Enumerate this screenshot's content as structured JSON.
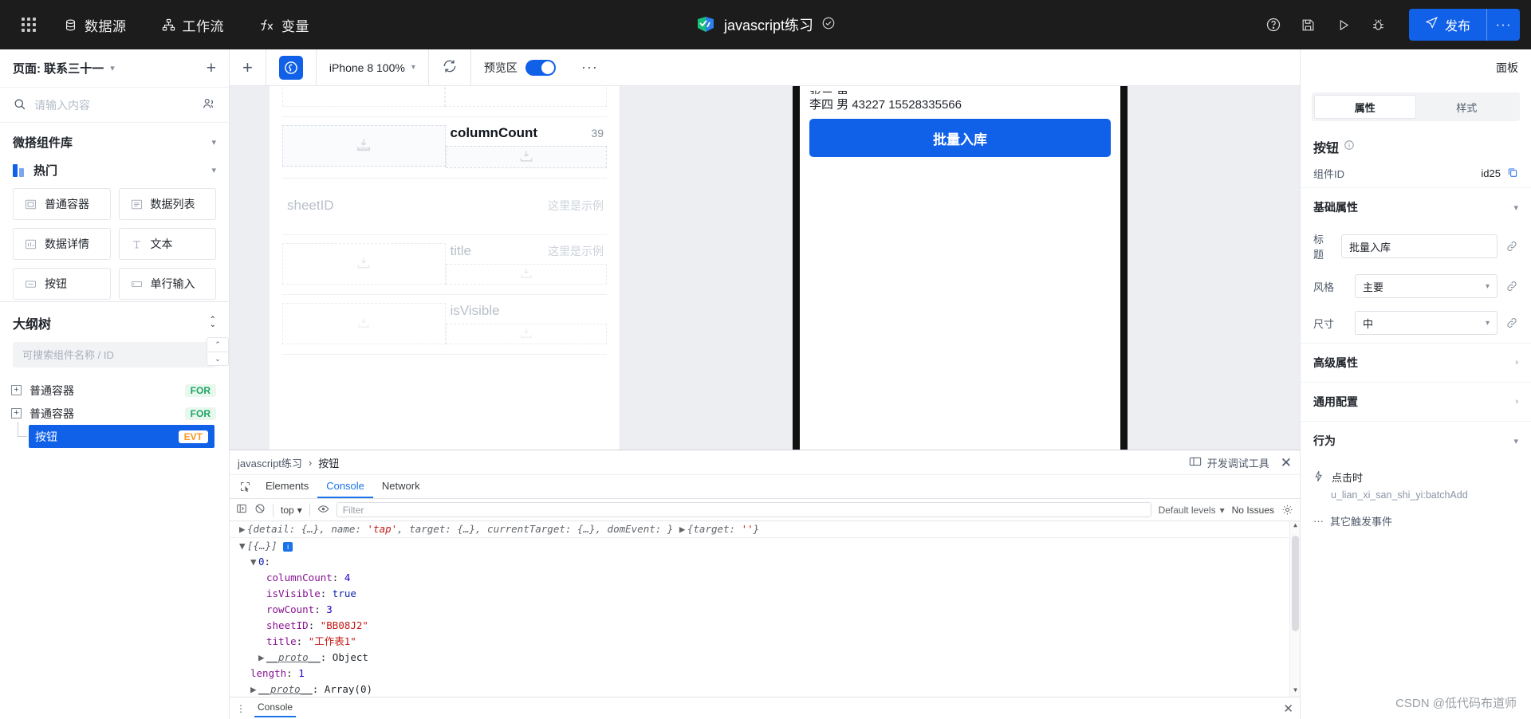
{
  "topbar": {
    "menu": [
      {
        "label": "数据源",
        "icon": "database-icon"
      },
      {
        "label": "工作流",
        "icon": "workflow-icon"
      },
      {
        "label": "变量",
        "icon": "function-icon"
      }
    ],
    "app_title": "javascript练习",
    "icons": [
      "help-icon",
      "save-icon",
      "play-icon",
      "debug-icon"
    ],
    "publish_label": "发布",
    "more_label": "···"
  },
  "sidebar": {
    "page_prefix": "页面:",
    "page_name": "联系三十一",
    "add_label": "+",
    "search_placeholder": "请输入内容",
    "library_title": "微搭组件库",
    "group_title": "热门",
    "components": [
      {
        "label": "普通容器",
        "icon": "container-icon"
      },
      {
        "label": "数据列表",
        "icon": "list-icon"
      },
      {
        "label": "数据详情",
        "icon": "detail-icon"
      },
      {
        "label": "文本",
        "icon": "text-icon"
      },
      {
        "label": "按钮",
        "icon": "button-icon"
      },
      {
        "label": "单行输入",
        "icon": "input-icon"
      }
    ],
    "outline_title": "大纲树",
    "outline_placeholder": "可搜索组件名称 / ID",
    "tree": [
      {
        "label": "普通容器",
        "tag": "FOR",
        "selected": false,
        "child": false
      },
      {
        "label": "普通容器",
        "tag": "FOR",
        "selected": false,
        "child": false
      },
      {
        "label": "按钮",
        "tag": "EVT",
        "selected": true,
        "child": true
      }
    ]
  },
  "canvas": {
    "device_label": "iPhone 8 100%",
    "preview_label": "预览区",
    "preview_on": true,
    "more_label": "···",
    "design_fields": [
      {
        "name": "columnCount",
        "value": "39",
        "muted": false
      },
      {
        "name": "sheetID",
        "value": "这里是示例",
        "muted": true
      },
      {
        "name": "title",
        "value": "这里是示例",
        "muted": true
      },
      {
        "name": "isVisible",
        "value": "",
        "muted": true
      }
    ],
    "phone": {
      "row_clipped": "张三 男",
      "row_text": "李四 男 43227 15528335566",
      "button_label": "批量入库"
    }
  },
  "devtools": {
    "breadcrumb_app": "javascript练习",
    "breadcrumb_sep": "›",
    "breadcrumb_node": "按钮",
    "panel_label": "开发调试工具",
    "close_label": "✕",
    "tabs": [
      {
        "label": "Elements",
        "active": false
      },
      {
        "label": "Console",
        "active": true
      },
      {
        "label": "Network",
        "active": false
      }
    ],
    "context": "top",
    "filter_placeholder": "Filter",
    "levels_label": "Default levels",
    "issues_label": "No Issues",
    "console_lines": [
      {
        "type": "event",
        "text": "{detail: {…}, name: 'tap', target: {…}, currentTarget: {…}, domEvent: }",
        "tail": "{target: ''}"
      },
      {
        "type": "array_head",
        "text": "[{…}]"
      },
      {
        "type": "index",
        "text": "0:"
      },
      {
        "type": "prop",
        "key": "columnCount",
        "value": "4",
        "kind": "num"
      },
      {
        "type": "prop",
        "key": "isVisible",
        "value": "true",
        "kind": "bool"
      },
      {
        "type": "prop",
        "key": "rowCount",
        "value": "3",
        "kind": "num"
      },
      {
        "type": "prop",
        "key": "sheetID",
        "value": "\"BB08J2\"",
        "kind": "str"
      },
      {
        "type": "prop",
        "key": "title",
        "value": "\"工作表1\"",
        "kind": "str"
      },
      {
        "type": "proto",
        "text": "__proto__",
        "value": "Object"
      },
      {
        "type": "prop",
        "key": "length",
        "value": "1",
        "kind": "num"
      },
      {
        "type": "proto",
        "text": "__proto__",
        "value": "Array(0)"
      }
    ],
    "prompt": "›",
    "footer_tab": "Console"
  },
  "rightpanel": {
    "panel_label": "面板",
    "tabs": [
      {
        "label": "属性",
        "active": true
      },
      {
        "label": "样式",
        "active": false
      }
    ],
    "component_title": "按钮",
    "component_id_label": "组件ID",
    "component_id_value": "id25",
    "sections": {
      "basic": "基础属性",
      "advanced": "高级属性",
      "common": "通用配置",
      "behavior": "行为"
    },
    "fields": [
      {
        "label": "标题",
        "type": "input",
        "value": "批量入库"
      },
      {
        "label": "风格",
        "type": "select",
        "value": "主要"
      },
      {
        "label": "尺寸",
        "type": "select",
        "value": "中"
      }
    ],
    "behavior": {
      "event_label": "点击时",
      "handler": "u_lian_xi_san_shi_yi:batchAdd",
      "more_label": "其它触发事件"
    }
  },
  "watermark": "CSDN @低代码布道师"
}
